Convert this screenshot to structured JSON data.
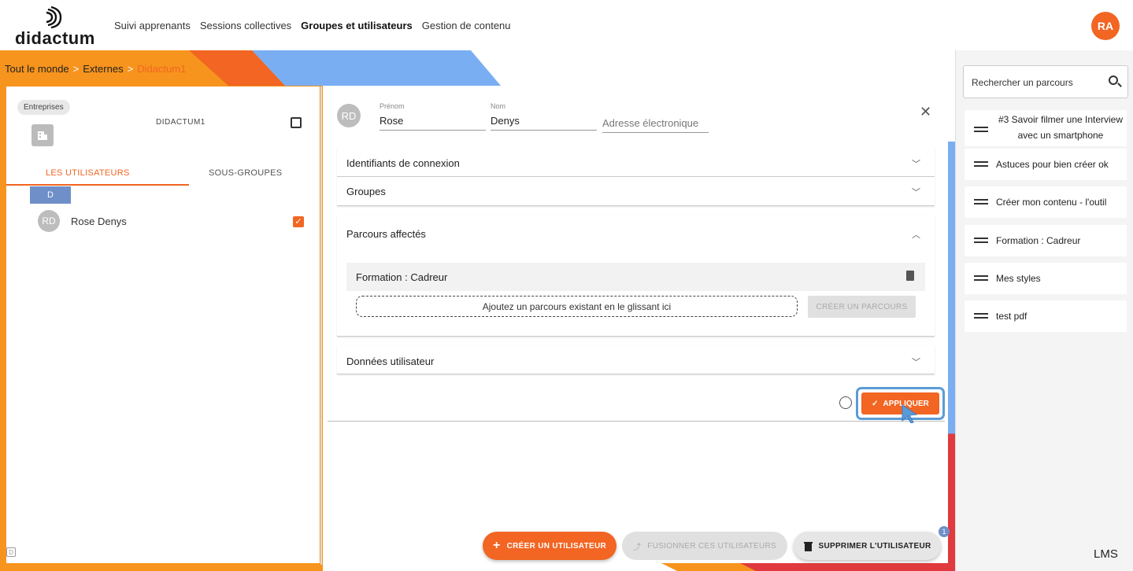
{
  "brand": {
    "name": "didactum",
    "footer_brand": "LMS"
  },
  "nav": {
    "items": [
      "Suivi apprenants",
      "Sessions collectives",
      "Groupes et utilisateurs",
      "Gestion de contenu"
    ],
    "active_index": 2
  },
  "user": {
    "initials": "RA"
  },
  "breadcrumb": {
    "level1": "Tout le monde",
    "level2": "Externes",
    "current": "Didactum1",
    "separator": ">"
  },
  "group_panel": {
    "chip": "Entreprises",
    "group_name": "DIDACTUM1",
    "tab_users": "LES UTILISATEURS",
    "tab_subgroups": "SOUS-GROUPES",
    "letter": "D",
    "users": [
      {
        "initials": "RD",
        "name": "Rose Denys",
        "checked": true
      }
    ],
    "corner_badge": "D"
  },
  "user_form": {
    "initials": "RD",
    "first_name_label": "Prénom",
    "first_name": "Rose",
    "last_name_label": "Nom",
    "last_name": "Denys",
    "email_placeholder": "Adresse électronique",
    "sections": {
      "login": "Identifiants de connexion",
      "groups": "Groupes",
      "courses": "Parcours affectés",
      "user_data": "Données utilisateur"
    },
    "assigned_course": "Formation : Cadreur",
    "drop_hint": "Ajoutez un parcours existant en le glissant ici",
    "create_course_btn": "CRÉER UN PARCOURS",
    "apply_btn": "APPLIQUER"
  },
  "bottom_actions": {
    "create_user": "CRÉER UN UTILISATEUR",
    "merge_users": "FUSIONNER CES UTILISATEURS",
    "delete_user": "SUPPRIMER L'UTILISATEUR",
    "selection_count": "1"
  },
  "course_sidebar": {
    "search_placeholder": "Rechercher un parcours",
    "courses": [
      "#3 Savoir filmer une Interview avec un smartphone",
      "Astuces pour bien créer ok",
      "Créer mon contenu - l'outil",
      "Formation : Cadreur",
      "Mes styles",
      "test pdf"
    ]
  },
  "colors": {
    "accent": "#f26522",
    "blue": "#7aaef2",
    "orange": "#f7941d",
    "red": "#e03a3e"
  }
}
